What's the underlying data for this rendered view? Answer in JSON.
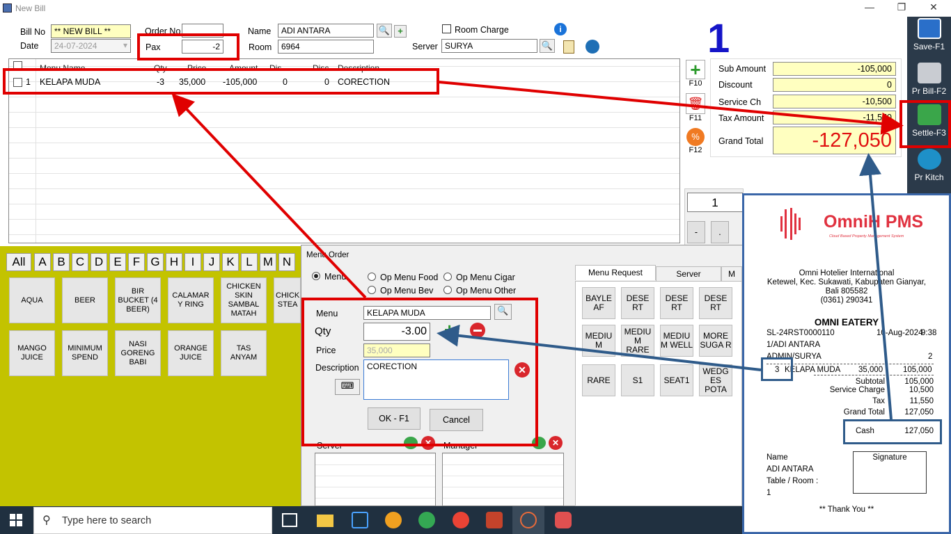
{
  "window": {
    "title": "New Bill",
    "minimize": "—",
    "restore": "❐",
    "close": "✕"
  },
  "header": {
    "bill_no_label": "Bill No",
    "bill_no": "** NEW BILL **",
    "date_label": "Date",
    "date": "24-07-2024",
    "order_no_label": "Order No",
    "order_no": "",
    "pax_label": "Pax",
    "pax": "-2",
    "name_label": "Name",
    "name": "ADI ANTARA",
    "room_label": "Room",
    "room": "6964",
    "room_charge_label": "Room Charge",
    "server_label": "Server",
    "server": "SURYA",
    "order_count": "1"
  },
  "grid": {
    "columns": [
      "Menu Name",
      "Qty",
      "Price",
      "Amount",
      "Dis",
      "Disc",
      "Description"
    ],
    "rows": [
      {
        "no": "1",
        "menu": "KELAPA MUDA",
        "qty": "-3",
        "price": "35,000",
        "amount": "-105,000",
        "dis": "0",
        "disc": "0",
        "desc": "CORECTION"
      }
    ]
  },
  "side_actions": {
    "f10": "F10",
    "f11": "F11",
    "f12": "F12"
  },
  "totals": {
    "sub_amount_label": "Sub Amount",
    "sub_amount": "-105,000",
    "discount_label": "Discount",
    "discount": "0",
    "service_label": "Service Ch",
    "service": "-10,500",
    "tax_label": "Tax Amount",
    "tax": "-11,550",
    "grand_label": "Grand Total",
    "grand": "-127,050"
  },
  "numpad": {
    "display": "1",
    "minus": "-",
    "dot": "."
  },
  "right_bar": {
    "save": "Save-F1",
    "print_bill": "Pr Bill-F2",
    "settle": "Settle-F3",
    "print_kitchen": "Pr Kitch"
  },
  "category_letters": [
    "All",
    "A",
    "B",
    "C",
    "D",
    "E",
    "F",
    "G",
    "H",
    "I",
    "J",
    "K",
    "L",
    "M",
    "N"
  ],
  "menu_items": [
    "AQUA",
    "BEER",
    "BIR BUCKET (4 BEER)",
    "CALAMAR Y RING",
    "CHICKEN SKIN SAMBAL MATAH",
    "CHICK STEA",
    "MANGO JUICE",
    "MINIMUM SPEND",
    "NASI GORENG BABI",
    "ORANGE JUICE",
    "TAS ANYAM"
  ],
  "dialog": {
    "title": "Menu Order",
    "radio_menu": "Menu",
    "radio_food": "Op Menu Food",
    "radio_cigar": "Op Menu Cigar",
    "radio_bev": "Op Menu Bev",
    "radio_other": "Op Menu Other",
    "menu_label": "Menu",
    "menu": "KELAPA MUDA",
    "qty_label": "Qty",
    "qty": "-3.00",
    "price_label": "Price",
    "price": "35,000",
    "desc_label": "Description",
    "desc": "CORECTION",
    "ok": "OK - F1",
    "cancel": "Cancel",
    "server_label": "Server",
    "manager_label": "Manager",
    "tab_request": "Menu Request",
    "tab_server": "Server",
    "tab_more": "M",
    "requests": [
      "BAYLE AF",
      "DESE RT",
      "DESE RT",
      "DESE RT",
      "MEDIU M",
      "MEDIU M RARE",
      "MEDIU M WELL",
      "MORE SUGA R",
      "RARE",
      "S1",
      "SEAT1",
      "WEDG ES POTA"
    ]
  },
  "receipt": {
    "brand": "OmniH PMS",
    "brand_tagline": "Cloud Based Property Management System",
    "hotel": "Omni Hotelier International",
    "address1": "Ketewel, Kec. Sukawati, Kabupaten Gianyar,",
    "address2": "Bali 805582",
    "phone": "(0361) 290341",
    "outlet": "OMNI EATERY",
    "bill_no": "SL-24RST0000110",
    "date": "10-Aug-2024",
    "time": "9:38",
    "guest": "1/ADI ANTARA",
    "user": "ADMIN/SURYA",
    "pax": "2",
    "item_qty": "3",
    "item_name": "KELAPA MUDA",
    "item_price": "35,000",
    "item_amount": "105,000",
    "subtotal_label": "Subtotal",
    "subtotal": "105,000",
    "service_label": "Service Charge",
    "service": "10,500",
    "tax_label": "Tax",
    "tax": "11,550",
    "grand_label": "Grand Total",
    "grand": "127,050",
    "cash_label": "Cash",
    "cash": "127,050",
    "name_label": "Name",
    "name": "ADI ANTARA",
    "table_label": "Table / Room :",
    "table": "1",
    "signature_label": "Signature",
    "thanks": "** Thank You **"
  },
  "taskbar": {
    "search_placeholder": "Type here to search"
  }
}
